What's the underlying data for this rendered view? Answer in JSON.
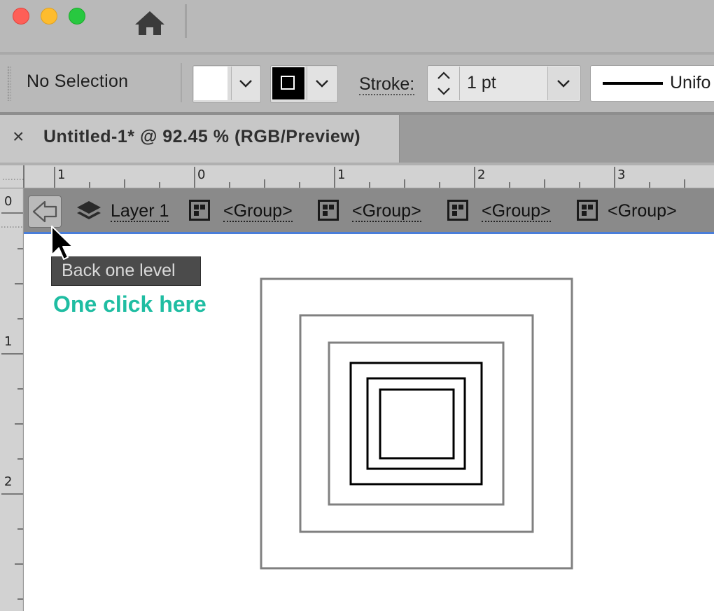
{
  "window": {
    "traffic_lights": {
      "close": "#fe5f57",
      "minimize": "#febc2e",
      "maximize": "#28c840"
    },
    "home_icon": "home-icon"
  },
  "control_bar": {
    "selection_label": "No Selection",
    "stroke_label": "Stroke:",
    "stroke_weight": "1 pt",
    "profile_label": "Unifo"
  },
  "document_tab": {
    "close_glyph": "×",
    "title": "Untitled-1* @ 92.45 % (RGB/Preview)"
  },
  "rulers": {
    "horizontal_labels": [
      "1",
      "0",
      "1",
      "2",
      "3"
    ],
    "vertical_labels": [
      "0",
      "1",
      "2"
    ]
  },
  "isolation_bar": {
    "back_icon": "arrow-left-outline-icon",
    "layer_label": "Layer 1",
    "groups": [
      "<Group>",
      "<Group>",
      "<Group>",
      "<Group>"
    ],
    "accent": "#4a7ed9"
  },
  "tooltip": {
    "text": "Back one level"
  },
  "annotation": {
    "text": "One click here",
    "color": "#1fbda2"
  }
}
